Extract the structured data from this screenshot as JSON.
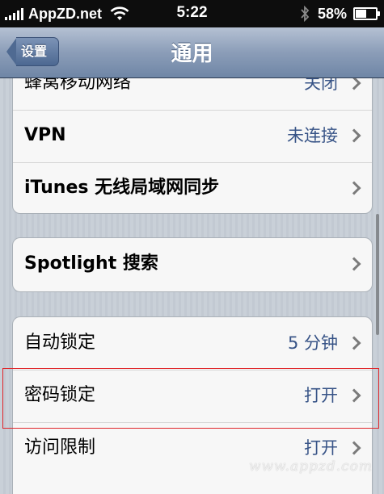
{
  "status_bar": {
    "carrier": "AppZD.net",
    "time": "5:22",
    "battery_percent": "58%",
    "battery_level": 0.58,
    "signal_bars": 5
  },
  "nav": {
    "back_label": "设置",
    "title": "通用"
  },
  "group1": [
    {
      "label": "蜂窝移动网络",
      "value": "关闭"
    },
    {
      "label": "VPN",
      "value": "未连接"
    },
    {
      "label": "iTunes 无线局域网同步",
      "value": ""
    }
  ],
  "group2": [
    {
      "label": "Spotlight 搜索",
      "value": ""
    }
  ],
  "group3": [
    {
      "label": "自动锁定",
      "value": "5 分钟"
    },
    {
      "label": "密码锁定",
      "value": "打开"
    },
    {
      "label": "访问限制",
      "value": "打开"
    }
  ],
  "watermark": "www.appzd.com",
  "colors": {
    "status_bar_bg": "#0d0d0d",
    "value_text": "#385487",
    "highlight": "#e0262a"
  },
  "icons": [
    "signal-icon",
    "wifi-icon",
    "bluetooth-icon",
    "battery-icon",
    "back-arrow-icon",
    "chevron-right-icon"
  ]
}
